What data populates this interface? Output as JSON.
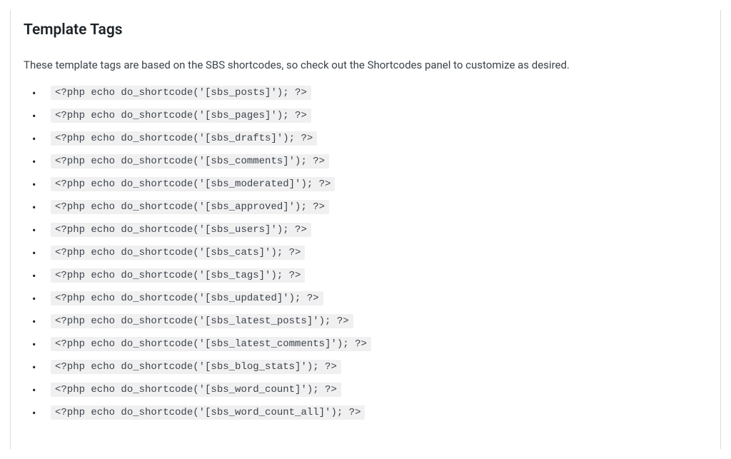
{
  "heading": "Template Tags",
  "description": "These template tags are based on the SBS shortcodes, so check out the Shortcodes panel to customize as desired.",
  "template_tags": [
    "<?php echo do_shortcode('[sbs_posts]'); ?>",
    "<?php echo do_shortcode('[sbs_pages]'); ?>",
    "<?php echo do_shortcode('[sbs_drafts]'); ?>",
    "<?php echo do_shortcode('[sbs_comments]'); ?>",
    "<?php echo do_shortcode('[sbs_moderated]'); ?>",
    "<?php echo do_shortcode('[sbs_approved]'); ?>",
    "<?php echo do_shortcode('[sbs_users]'); ?>",
    "<?php echo do_shortcode('[sbs_cats]'); ?>",
    "<?php echo do_shortcode('[sbs_tags]'); ?>",
    "<?php echo do_shortcode('[sbs_updated]'); ?>",
    "<?php echo do_shortcode('[sbs_latest_posts]'); ?>",
    "<?php echo do_shortcode('[sbs_latest_comments]'); ?>",
    "<?php echo do_shortcode('[sbs_blog_stats]'); ?>",
    "<?php echo do_shortcode('[sbs_word_count]'); ?>",
    "<?php echo do_shortcode('[sbs_word_count_all]'); ?>"
  ]
}
